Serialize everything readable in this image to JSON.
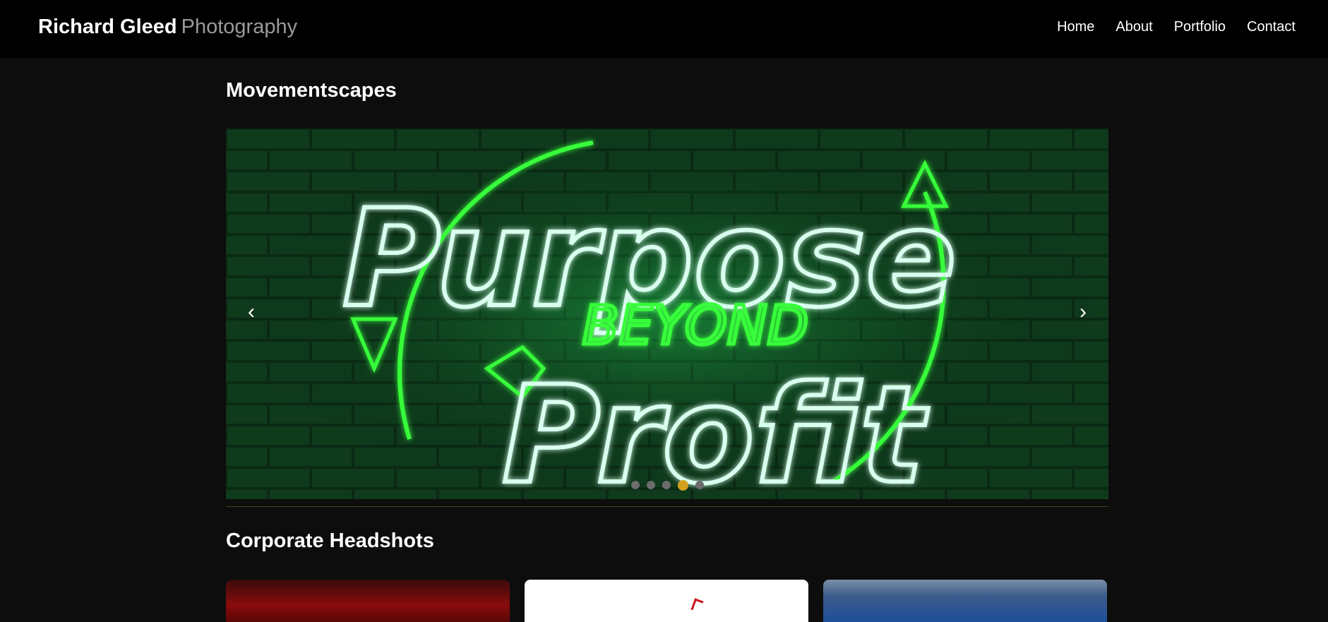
{
  "header": {
    "brand_name": "Richard Gleed",
    "brand_sub": "Photography",
    "nav": [
      "Home",
      "About",
      "Portfolio",
      "Contact"
    ]
  },
  "sections": [
    {
      "title": "Movementscapes",
      "slider": {
        "prev_label": "‹",
        "next_label": "›",
        "dot_count": 5,
        "active_dot": 4,
        "image_text": {
          "top": "Purpose",
          "middle": "BEYOND",
          "bottom": "Profit"
        }
      }
    },
    {
      "title": "Corporate Headshots"
    }
  ],
  "colors": {
    "header_bg": "#000000",
    "page_bg": "#0d0d0d",
    "accent": "#d4a11e",
    "neon_green": "#39ff3a",
    "neon_white": "#d9ffef"
  },
  "icons": {
    "prev": "chevron-left-icon",
    "next": "chevron-right-icon"
  }
}
